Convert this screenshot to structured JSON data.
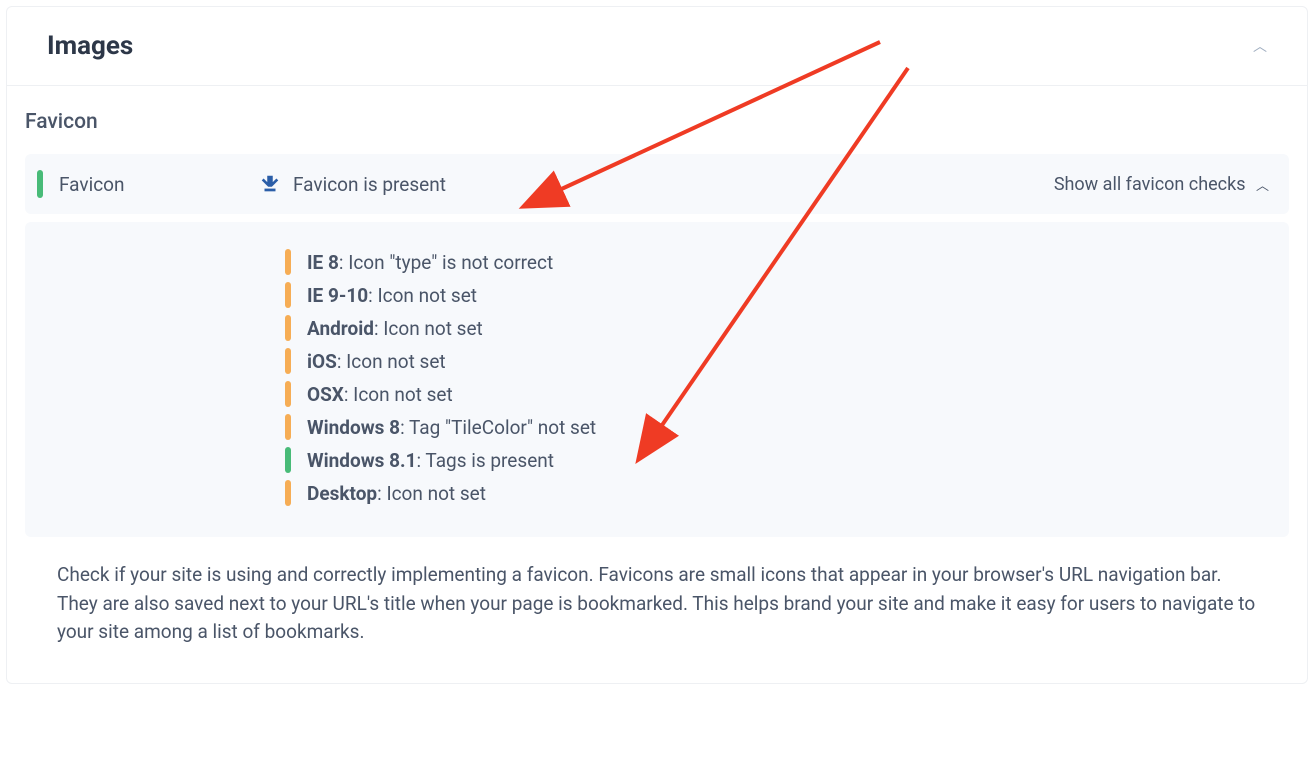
{
  "panel": {
    "title": "Images"
  },
  "section": {
    "title": "Favicon",
    "summary": {
      "label": "Favicon",
      "value": "Favicon is present",
      "status": "green"
    },
    "toggle_label": "Show all favicon checks",
    "checks": [
      {
        "status": "yellow",
        "label": "IE 8",
        "msg": "Icon \"type\" is not correct"
      },
      {
        "status": "yellow",
        "label": "IE 9-10",
        "msg": "Icon not set"
      },
      {
        "status": "yellow",
        "label": "Android",
        "msg": "Icon not set"
      },
      {
        "status": "yellow",
        "label": "iOS",
        "msg": "Icon not set"
      },
      {
        "status": "yellow",
        "label": "OSX",
        "msg": "Icon not set"
      },
      {
        "status": "yellow",
        "label": "Windows 8",
        "msg": "Tag \"TileColor\" not set"
      },
      {
        "status": "green",
        "label": "Windows 8.1",
        "msg": "Tags is present"
      },
      {
        "status": "yellow",
        "label": "Desktop",
        "msg": "Icon not set"
      }
    ],
    "description_line1": "Check if your site is using and correctly implementing a favicon. Favicons are small icons that appear in your browser's URL navigation bar.",
    "description_line2": "They are also saved next to your URL's title when your page is bookmarked. This helps brand your site and make it easy for users to navigate to your site among a list of bookmarks."
  },
  "colors": {
    "arrow": "#ef3b24"
  }
}
